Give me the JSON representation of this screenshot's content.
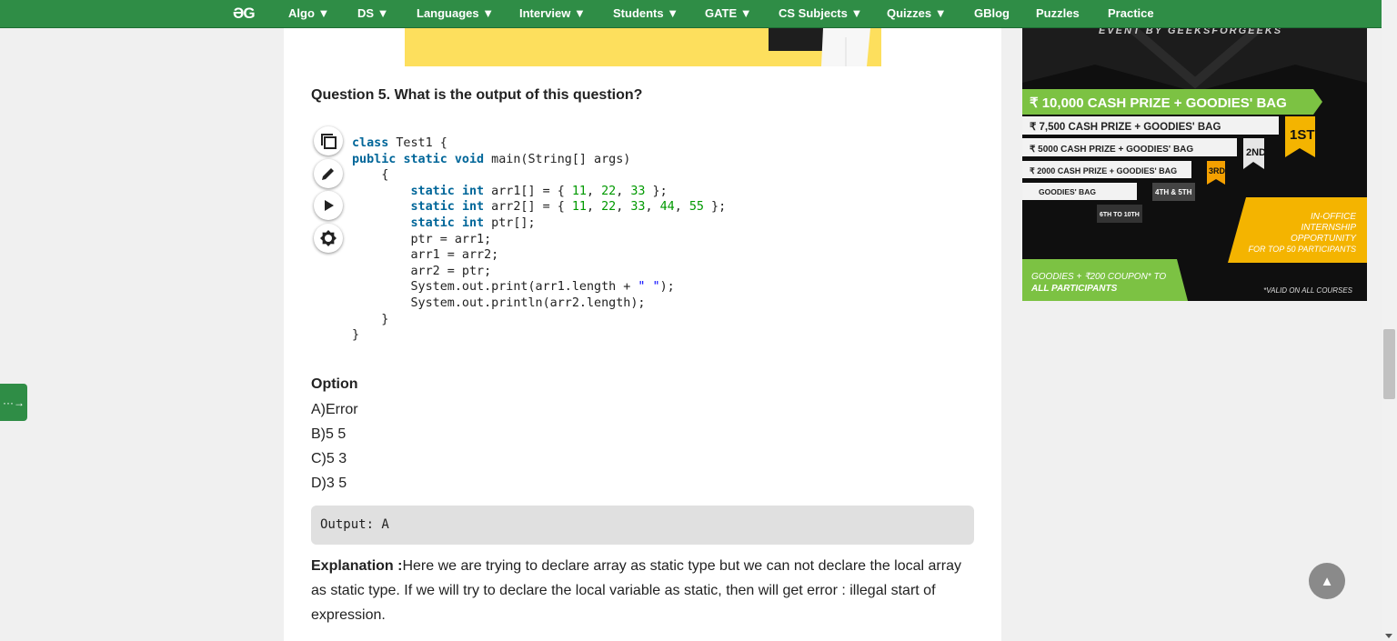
{
  "nav": {
    "logo": "ƏG",
    "items": [
      "Algo ▼",
      "DS ▼",
      "Languages ▼",
      "Interview ▼",
      "Students ▼",
      "GATE ▼",
      "CS Subjects ▼",
      "Quizzes ▼",
      "GBlog",
      "Puzzles",
      "Practice"
    ]
  },
  "question": {
    "title": "Question 5. What is the output of this question?",
    "code_lines": [
      "class Test1 {",
      "public static void main(String[] args)",
      "    {",
      "        static int arr1[] = { 11, 22, 33 };",
      "        static int arr2[] = { 11, 22, 33, 44, 55 };",
      "        static int ptr[];",
      "        ptr = arr1;",
      "        arr1 = arr2;",
      "        arr2 = ptr;",
      "        System.out.print(arr1.length + \" \");",
      "        System.out.println(arr2.length);",
      "    }",
      "}"
    ]
  },
  "options": {
    "heading": "Option",
    "items": [
      "A)Error",
      "B)5 5",
      "C)5 3",
      "D)3 5"
    ]
  },
  "output": "Output: A",
  "explanation": {
    "label": "Explanation :",
    "text": "Here we are trying to declare array as static type but we can not declare the local array as static type. If we will try to declare the local variable as static, then will get error : illegal start of expression."
  },
  "ad": {
    "header": "EVENT BY GEEKSFORGEEKS",
    "prize1": "₹ 10,000 CASH PRIZE + GOODIES' BAG",
    "prize2": "₹ 7,500 CASH PRIZE + GOODIES' BAG",
    "prize3": "₹ 5000 CASH PRIZE + GOODIES' BAG",
    "prize4": "₹ 2000 CASH PRIZE + GOODIES' BAG",
    "prize5": "GOODIES' BAG",
    "rank1": "1ST",
    "rank2": "2ND",
    "rank3": "3RD",
    "rank45": "4TH & 5TH",
    "rank610": "6TH TO 10TH",
    "internship": [
      "IN-OFFICE",
      "INTERNSHIP",
      "OPPORTUNITY",
      "FOR TOP 50 PARTICIPANTS"
    ],
    "coupon": [
      "GOODIES + ₹200 COUPON* TO",
      "ALL PARTICIPANTS"
    ],
    "valid": "*VALID ON ALL COURSES"
  },
  "side_button": "···→",
  "scroll_top": "▲",
  "colors": {
    "nav": "#2f8d46",
    "ad_green": "#7cc243",
    "ad_gold": "#f4b400"
  }
}
